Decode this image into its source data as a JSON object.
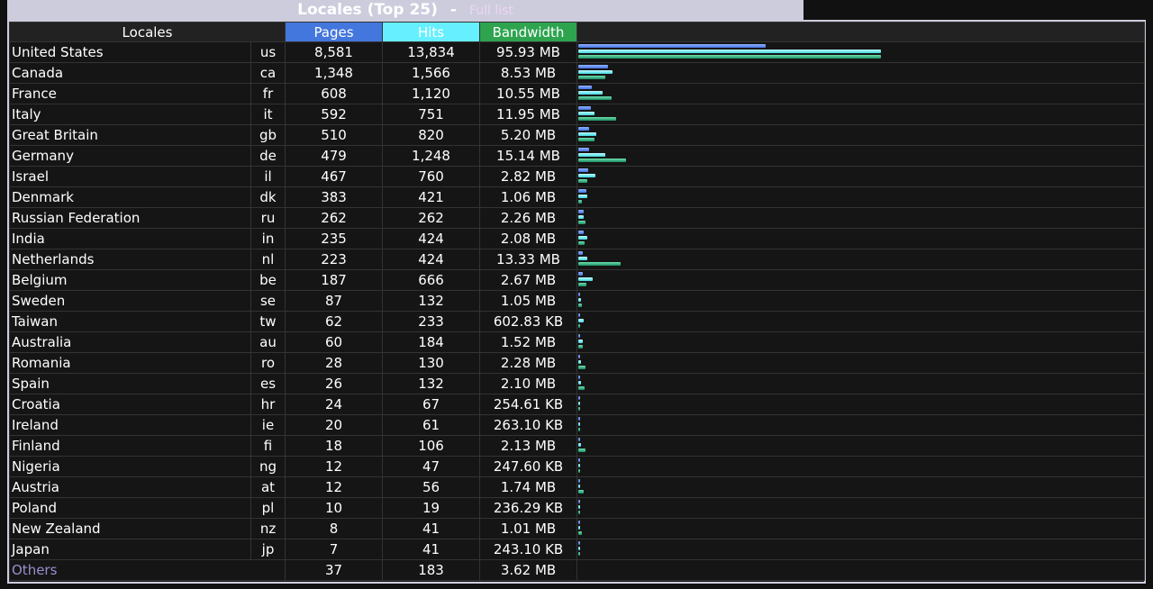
{
  "header": {
    "title": "Locales (Top 25)",
    "separator": "-",
    "full_list_link": "Full list"
  },
  "columns": {
    "locales": "Locales",
    "pages": "Pages",
    "hits": "Hits",
    "bandwidth": "Bandwidth"
  },
  "colors": {
    "pages": "#4477dd",
    "hits": "#66f0ff",
    "bandwidth": "#2ea44f",
    "others_label": "#9a8fd0"
  },
  "rows": [
    {
      "name": "United States",
      "code": "us",
      "pages": "8,581",
      "hits": "13,834",
      "bandwidth": "95.93 MB",
      "pages_val": 8581,
      "hits_val": 13834,
      "bw_mb": 95.93
    },
    {
      "name": "Canada",
      "code": "ca",
      "pages": "1,348",
      "hits": "1,566",
      "bandwidth": "8.53 MB",
      "pages_val": 1348,
      "hits_val": 1566,
      "bw_mb": 8.53
    },
    {
      "name": "France",
      "code": "fr",
      "pages": "608",
      "hits": "1,120",
      "bandwidth": "10.55 MB",
      "pages_val": 608,
      "hits_val": 1120,
      "bw_mb": 10.55
    },
    {
      "name": "Italy",
      "code": "it",
      "pages": "592",
      "hits": "751",
      "bandwidth": "11.95 MB",
      "pages_val": 592,
      "hits_val": 751,
      "bw_mb": 11.95
    },
    {
      "name": "Great Britain",
      "code": "gb",
      "pages": "510",
      "hits": "820",
      "bandwidth": "5.20 MB",
      "pages_val": 510,
      "hits_val": 820,
      "bw_mb": 5.2
    },
    {
      "name": "Germany",
      "code": "de",
      "pages": "479",
      "hits": "1,248",
      "bandwidth": "15.14 MB",
      "pages_val": 479,
      "hits_val": 1248,
      "bw_mb": 15.14
    },
    {
      "name": "Israel",
      "code": "il",
      "pages": "467",
      "hits": "760",
      "bandwidth": "2.82 MB",
      "pages_val": 467,
      "hits_val": 760,
      "bw_mb": 2.82
    },
    {
      "name": "Denmark",
      "code": "dk",
      "pages": "383",
      "hits": "421",
      "bandwidth": "1.06 MB",
      "pages_val": 383,
      "hits_val": 421,
      "bw_mb": 1.06
    },
    {
      "name": "Russian Federation",
      "code": "ru",
      "pages": "262",
      "hits": "262",
      "bandwidth": "2.26 MB",
      "pages_val": 262,
      "hits_val": 262,
      "bw_mb": 2.26
    },
    {
      "name": "India",
      "code": "in",
      "pages": "235",
      "hits": "424",
      "bandwidth": "2.08 MB",
      "pages_val": 235,
      "hits_val": 424,
      "bw_mb": 2.08
    },
    {
      "name": "Netherlands",
      "code": "nl",
      "pages": "223",
      "hits": "424",
      "bandwidth": "13.33 MB",
      "pages_val": 223,
      "hits_val": 424,
      "bw_mb": 13.33
    },
    {
      "name": "Belgium",
      "code": "be",
      "pages": "187",
      "hits": "666",
      "bandwidth": "2.67 MB",
      "pages_val": 187,
      "hits_val": 666,
      "bw_mb": 2.67
    },
    {
      "name": "Sweden",
      "code": "se",
      "pages": "87",
      "hits": "132",
      "bandwidth": "1.05 MB",
      "pages_val": 87,
      "hits_val": 132,
      "bw_mb": 1.05
    },
    {
      "name": "Taiwan",
      "code": "tw",
      "pages": "62",
      "hits": "233",
      "bandwidth": "602.83 KB",
      "pages_val": 62,
      "hits_val": 233,
      "bw_mb": 0.589
    },
    {
      "name": "Australia",
      "code": "au",
      "pages": "60",
      "hits": "184",
      "bandwidth": "1.52 MB",
      "pages_val": 60,
      "hits_val": 184,
      "bw_mb": 1.52
    },
    {
      "name": "Romania",
      "code": "ro",
      "pages": "28",
      "hits": "130",
      "bandwidth": "2.28 MB",
      "pages_val": 28,
      "hits_val": 130,
      "bw_mb": 2.28
    },
    {
      "name": "Spain",
      "code": "es",
      "pages": "26",
      "hits": "132",
      "bandwidth": "2.10 MB",
      "pages_val": 26,
      "hits_val": 132,
      "bw_mb": 2.1
    },
    {
      "name": "Croatia",
      "code": "hr",
      "pages": "24",
      "hits": "67",
      "bandwidth": "254.61 KB",
      "pages_val": 24,
      "hits_val": 67,
      "bw_mb": 0.249
    },
    {
      "name": "Ireland",
      "code": "ie",
      "pages": "20",
      "hits": "61",
      "bandwidth": "263.10 KB",
      "pages_val": 20,
      "hits_val": 61,
      "bw_mb": 0.257
    },
    {
      "name": "Finland",
      "code": "fi",
      "pages": "18",
      "hits": "106",
      "bandwidth": "2.13 MB",
      "pages_val": 18,
      "hits_val": 106,
      "bw_mb": 2.13
    },
    {
      "name": "Nigeria",
      "code": "ng",
      "pages": "12",
      "hits": "47",
      "bandwidth": "247.60 KB",
      "pages_val": 12,
      "hits_val": 47,
      "bw_mb": 0.242
    },
    {
      "name": "Austria",
      "code": "at",
      "pages": "12",
      "hits": "56",
      "bandwidth": "1.74 MB",
      "pages_val": 12,
      "hits_val": 56,
      "bw_mb": 1.74
    },
    {
      "name": "Poland",
      "code": "pl",
      "pages": "10",
      "hits": "19",
      "bandwidth": "236.29 KB",
      "pages_val": 10,
      "hits_val": 19,
      "bw_mb": 0.231
    },
    {
      "name": "New Zealand",
      "code": "nz",
      "pages": "8",
      "hits": "41",
      "bandwidth": "1.01 MB",
      "pages_val": 8,
      "hits_val": 41,
      "bw_mb": 1.01
    },
    {
      "name": "Japan",
      "code": "jp",
      "pages": "7",
      "hits": "41",
      "bandwidth": "243.10 KB",
      "pages_val": 7,
      "hits_val": 41,
      "bw_mb": 0.237
    }
  ],
  "others": {
    "name": "Others",
    "pages": "37",
    "hits": "183",
    "bandwidth": "3.62 MB"
  }
}
